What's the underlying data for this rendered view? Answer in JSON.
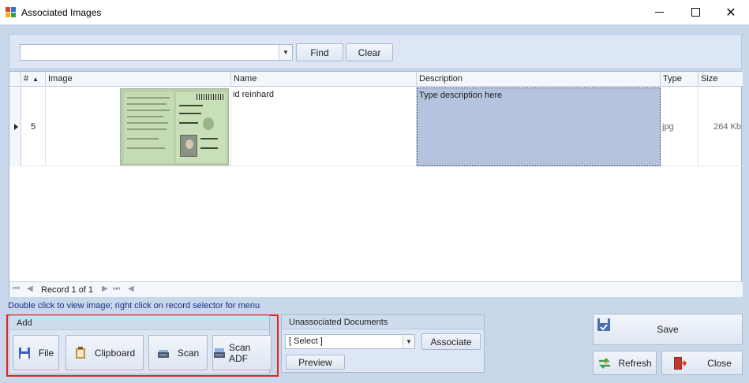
{
  "window": {
    "title": "Associated Images",
    "icon": "app-icon",
    "controls": [
      "minimize-icon",
      "maximize-icon",
      "close-icon"
    ]
  },
  "search": {
    "combo_value": "",
    "find_label": "Find",
    "clear_label": "Clear"
  },
  "grid": {
    "columns": [
      {
        "label": "#",
        "sort": "ascending"
      },
      {
        "label": "Image"
      },
      {
        "label": "Name"
      },
      {
        "label": "Description"
      },
      {
        "label": "Type"
      },
      {
        "label": "Size"
      }
    ],
    "rows": [
      {
        "number": "5",
        "image": "id-document-thumbnail",
        "name": "id reinhard",
        "description": "Type description here",
        "type": "jpg",
        "size": "264 Kb"
      }
    ],
    "footer": {
      "record_text": "Record 1 of 1"
    }
  },
  "hint_text": "Double click to view image; right click on record selector for menu",
  "add_group": {
    "title": "Add",
    "buttons": [
      {
        "label": "File",
        "icon": "floppy-disk-icon"
      },
      {
        "label": "Clipboard",
        "icon": "clipboard-icon"
      },
      {
        "label": "Scan",
        "icon": "scanner-icon"
      },
      {
        "label": "Scan ADF",
        "icon": "scanner-adf-icon"
      }
    ]
  },
  "unassociated": {
    "title": "Unassociated Documents",
    "select_value": "[ Select ]",
    "associate_label": "Associate",
    "preview_label": "Preview"
  },
  "actions": {
    "save_label": "Save",
    "refresh_label": "Refresh",
    "close_label": "Close"
  },
  "colors": {
    "client_background": "#c9d7eb",
    "selected_cell": "#b5c4de",
    "hint_text": "#1a2f8a",
    "highlight_border": "#e0261e"
  }
}
